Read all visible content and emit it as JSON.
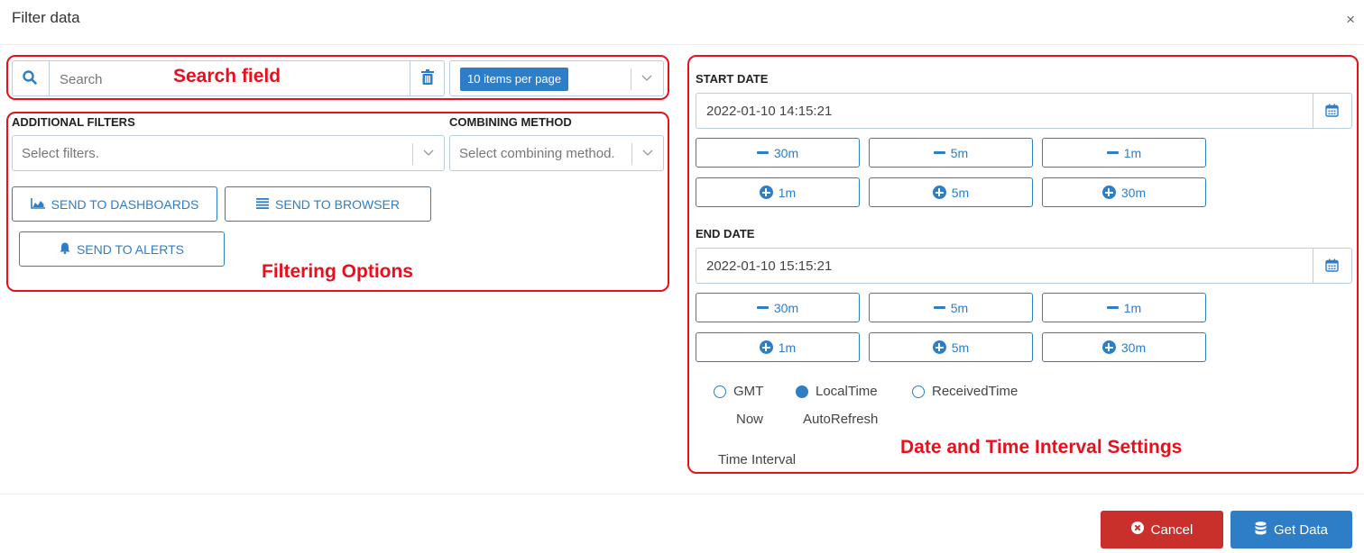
{
  "dialog": {
    "title": "Filter data",
    "close_glyph": "×"
  },
  "search": {
    "placeholder": "Search",
    "icon": "search-icon",
    "clear_icon": "trash-icon"
  },
  "page_size": {
    "selected": "10 items per page"
  },
  "filters": {
    "additional_label": "ADDITIONAL FILTERS",
    "additional_placeholder": "Select filters.",
    "combining_label": "COMBINING METHOD",
    "combining_placeholder": "Select combining method.",
    "send_dashboards": "SEND TO DASHBOARDS",
    "send_browser": "SEND TO BROWSER",
    "send_alerts": "SEND TO ALERTS"
  },
  "dates": {
    "start_label": "START DATE",
    "start_value": "2022-01-10 14:15:21",
    "end_label": "END DATE",
    "end_value": "2022-01-10 15:15:21",
    "minus_30m": "30m",
    "minus_5m": "5m",
    "minus_1m": "1m",
    "plus_1m": "1m",
    "plus_5m": "5m",
    "plus_30m": "30m"
  },
  "timezone": {
    "gmt": "GMT",
    "local": "LocalTime",
    "received": "ReceivedTime",
    "selected": "LocalTime"
  },
  "refresh": {
    "now": "Now",
    "autorefresh": "AutoRefresh",
    "time_interval": "Time Interval"
  },
  "annotations": {
    "search": "Search field",
    "filtering": "Filtering Options",
    "datetime": "Date and Time Interval Settings"
  },
  "footer": {
    "cancel": "Cancel",
    "get_data": "Get Data"
  },
  "colors": {
    "primary": "#2d7ec7",
    "danger": "#c9302c",
    "annotation": "#e8101c"
  }
}
